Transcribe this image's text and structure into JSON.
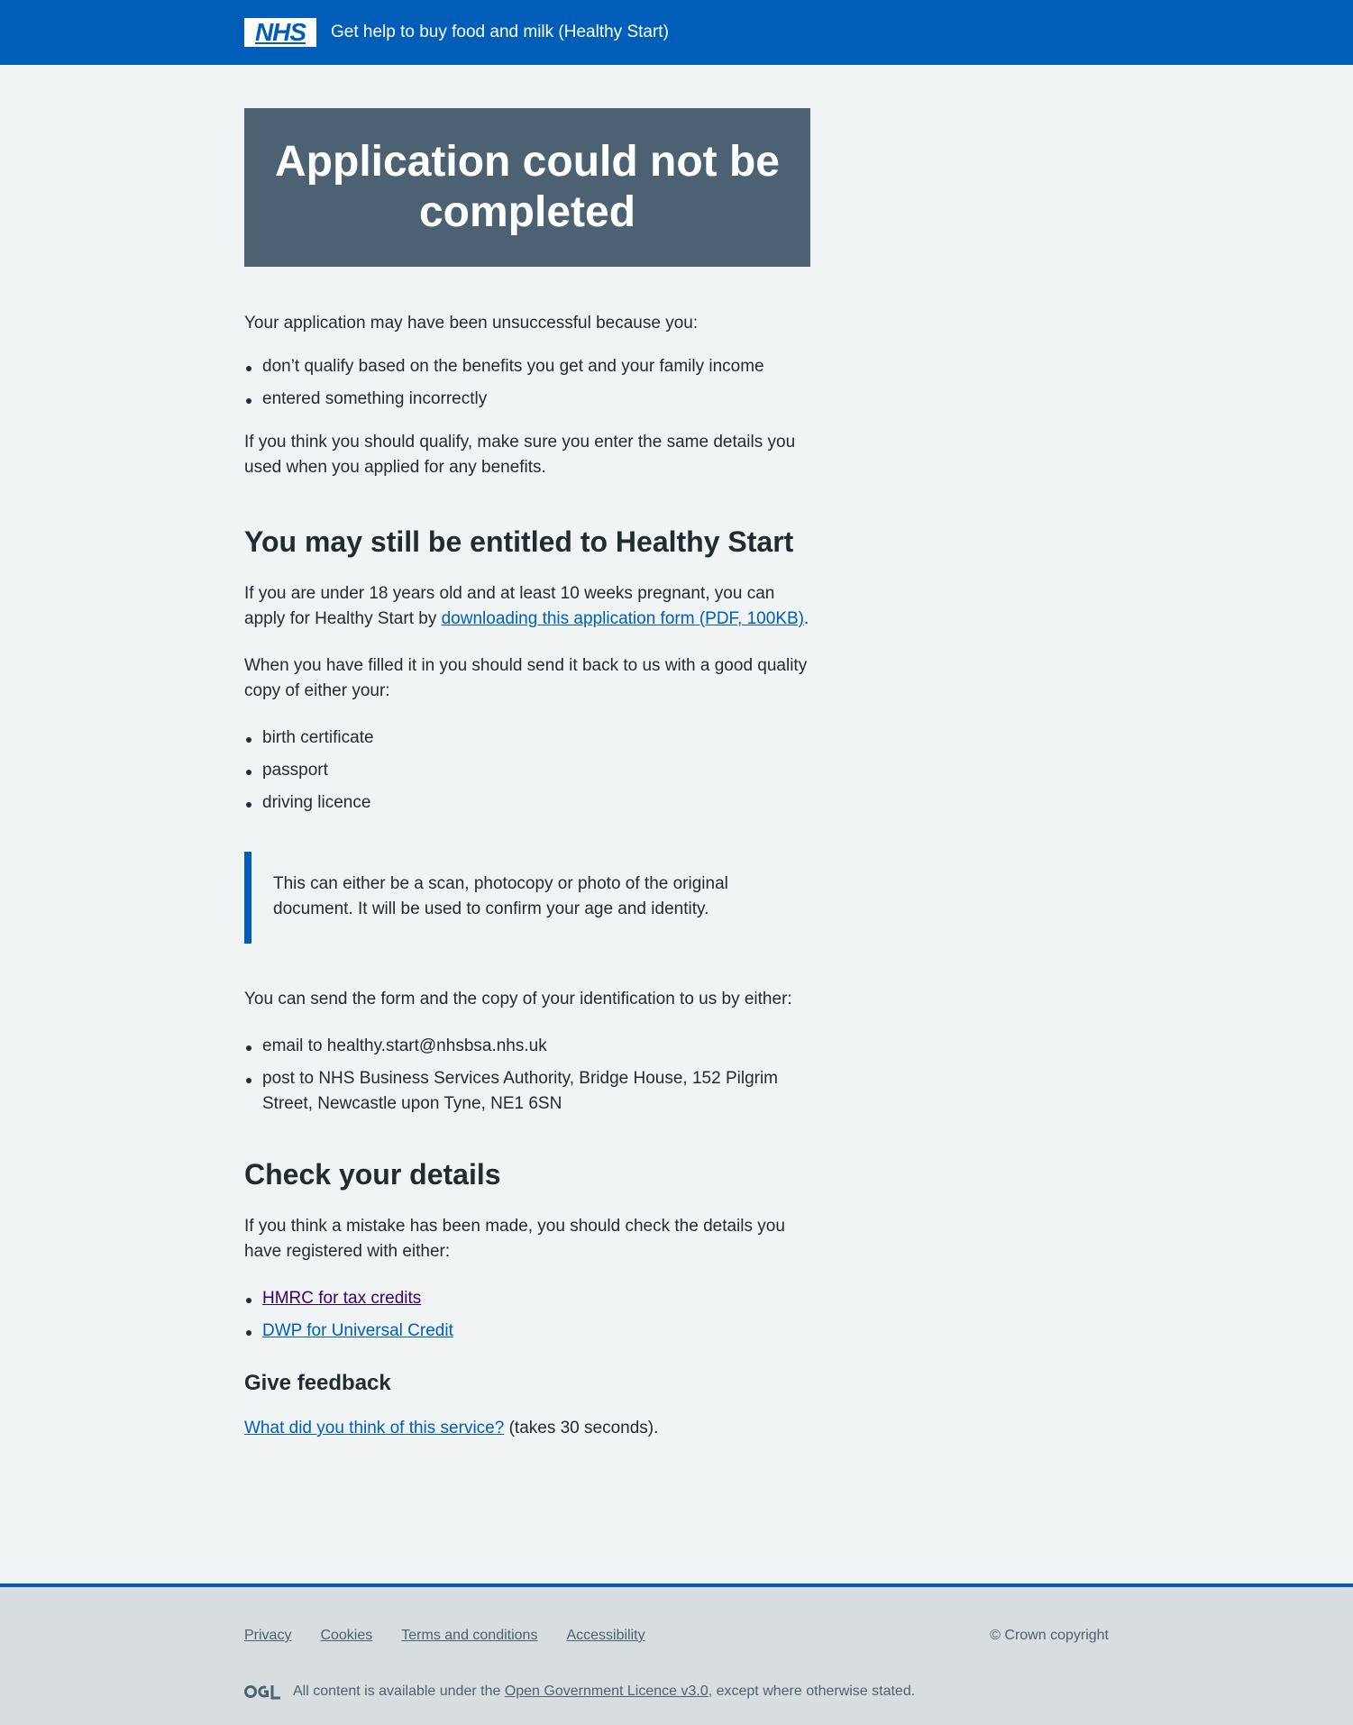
{
  "header": {
    "logo_text": "NHS",
    "service_name": "Get help to buy food and milk (Healthy Start)"
  },
  "panel": {
    "title": "Application could not be completed"
  },
  "intro": {
    "text": "Your application may have been unsuccessful because you:",
    "reasons": [
      "don’t qualify based on the benefits you get and your family income",
      "entered something incorrectly"
    ],
    "qualify_text": "If you think you should qualify, make sure you enter the same details you used when you applied for any benefits."
  },
  "entitled": {
    "heading": "You may still be entitled to Healthy Start",
    "para_before_link": "If you are under 18 years old and at least 10 weeks pregnant, you can apply for Healthy Start by ",
    "link_text": "downloading this application form (PDF, 100KB)",
    "para_after_link": ".",
    "filled_text": "When you have filled it in you should send it back to us with a good quality copy of either your:",
    "documents": [
      "birth certificate",
      "passport",
      "driving licence"
    ],
    "inset_text": "This can either be a scan, photocopy or photo of the original document. It will be used to confirm your age and identity.",
    "send_text": "You can send the form and the copy of your identification to us by either:",
    "send_methods": [
      "email to healthy.start@nhsbsa.nhs.uk",
      "post to NHS Business Services Authority, Bridge House, 152 Pilgrim Street, Newcastle upon Tyne, NE1 6SN"
    ]
  },
  "check": {
    "heading": "Check your details",
    "text": "If you think a mistake has been made, you should check the details you have registered with either:",
    "links": [
      "HMRC for tax credits",
      "DWP for Universal Credit"
    ]
  },
  "feedback": {
    "heading": "Give feedback",
    "link_text": "What did you think of this service?",
    "suffix": " (takes 30 seconds)."
  },
  "footer": {
    "links": [
      "Privacy",
      "Cookies",
      "Terms and conditions",
      "Accessibility"
    ],
    "copyright": "© Crown copyright",
    "licence_before": "All content is available under the ",
    "licence_link": "Open Government Licence v3.0",
    "licence_after": ", except where otherwise stated."
  },
  "colors": {
    "brand_blue": "#005eb8",
    "panel_grey": "#4c6272",
    "background": "#f0f4f5",
    "footer_bg": "#d8dde0",
    "visited_link": "#330072"
  },
  "icons": {
    "logo": "nhs-logo",
    "licence_logo": "ogl-logo"
  }
}
